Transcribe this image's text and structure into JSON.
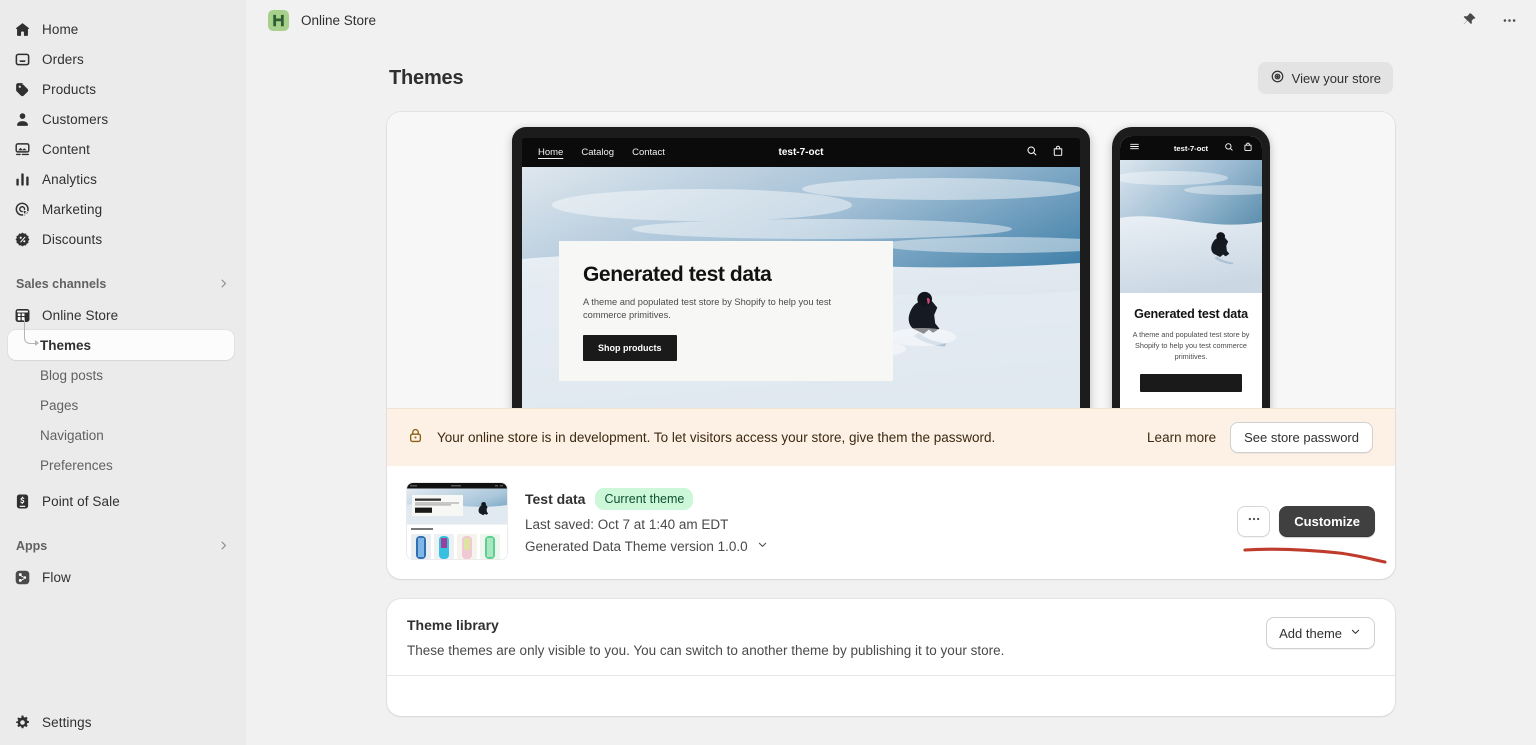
{
  "topbar": {
    "store_name": "Online Store",
    "logo_icon": "shopify-store-logo",
    "pin_icon": "pin-icon",
    "more_icon": "ellipsis-icon"
  },
  "sidebar": {
    "primary": [
      {
        "label": "Home",
        "icon": "home-icon"
      },
      {
        "label": "Orders",
        "icon": "orders-inbox-icon"
      },
      {
        "label": "Products",
        "icon": "products-tag-icon"
      },
      {
        "label": "Customers",
        "icon": "customer-person-icon"
      },
      {
        "label": "Content",
        "icon": "content-image-icon"
      },
      {
        "label": "Analytics",
        "icon": "analytics-bars-icon"
      },
      {
        "label": "Marketing",
        "icon": "marketing-target-icon"
      },
      {
        "label": "Discounts",
        "icon": "discount-badge-icon"
      }
    ],
    "sales_channels": {
      "label": "Sales channels",
      "chevron_icon": "chevron-right-icon",
      "items": [
        {
          "label": "Online Store",
          "icon": "storefront-icon"
        },
        {
          "label": "Point of Sale",
          "icon": "point-of-sale-icon"
        }
      ],
      "sub_items": [
        {
          "label": "Themes",
          "active": true
        },
        {
          "label": "Blog posts",
          "active": false
        },
        {
          "label": "Pages",
          "active": false
        },
        {
          "label": "Navigation",
          "active": false
        },
        {
          "label": "Preferences",
          "active": false
        }
      ]
    },
    "apps": {
      "label": "Apps",
      "chevron_icon": "chevron-right-icon",
      "items": [
        {
          "label": "Flow",
          "icon": "flow-app-icon"
        }
      ]
    },
    "settings": {
      "label": "Settings",
      "icon": "gear-icon"
    }
  },
  "page": {
    "title": "Themes",
    "view_store_button": {
      "label": "View your store",
      "icon": "eye-view-icon"
    }
  },
  "preview": {
    "desktop": {
      "nav_links": [
        "Home",
        "Catalog",
        "Contact"
      ],
      "active_link": "Home",
      "brand": "test-7-oct",
      "search_icon": "search-icon",
      "cart_icon": "shopping-bag-icon",
      "hero_heading": "Generated test data",
      "hero_body": "A theme and populated test store by Shopify to help you test commerce primitives.",
      "hero_button": "Shop products"
    },
    "mobile": {
      "menu_icon": "hamburger-menu-icon",
      "brand": "test-7-oct",
      "search_icon": "search-icon",
      "cart_icon": "shopping-bag-icon",
      "hero_heading": "Generated test data",
      "hero_body": "A theme and populated test store by Shopify to help you test commerce primitives."
    }
  },
  "dev_banner": {
    "lock_icon": "lock-icon",
    "message": "Your online store is in development. To let visitors access your store, give them the password.",
    "learn_more": "Learn more",
    "password_button": "See store password",
    "background_color": "#fdf0e4"
  },
  "current_theme": {
    "name": "Test data",
    "badge": "Current theme",
    "badge_color": "#cdf7d9",
    "last_saved": "Last saved: Oct 7 at 1:40 am EDT",
    "version": "Generated Data Theme version 1.0.0",
    "version_chevron_icon": "chevron-down-icon",
    "more_button_icon": "ellipsis-icon",
    "customize_button": "Customize",
    "annotation_color": "#c0392b",
    "thumbnail": {
      "hero_title": "Generated test data",
      "featured_label": "Featured products"
    }
  },
  "theme_library": {
    "title": "Theme library",
    "description": "These themes are only visible to you. You can switch to another theme by publishing it to your store.",
    "add_theme_button": {
      "label": "Add theme",
      "icon": "chevron-down-icon"
    }
  }
}
